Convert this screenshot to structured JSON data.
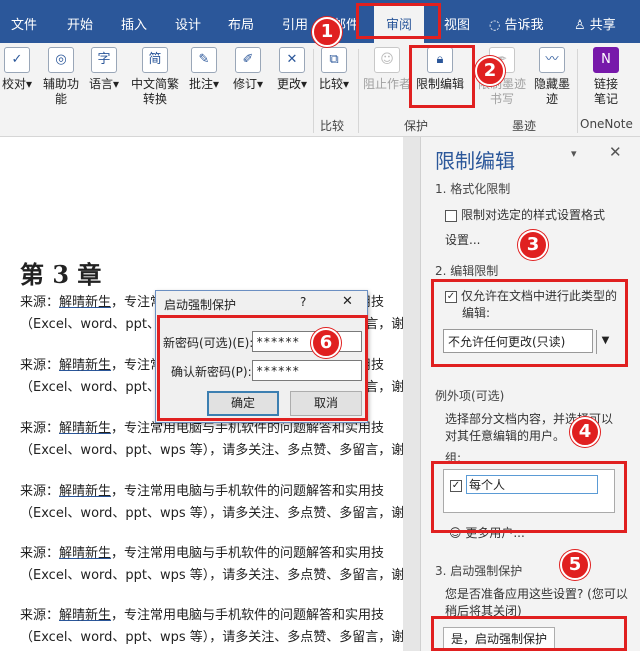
{
  "tabs": {
    "file": "文件",
    "home": "开始",
    "insert": "插入",
    "design": "设计",
    "layout": "布局",
    "references": "引用",
    "mailings": "邮件",
    "review": "审阅",
    "view": "视图",
    "tell_me": "告诉我",
    "share": "共享"
  },
  "ribbon": {
    "proofing": "校对",
    "accessibility": "辅助功能",
    "language": "语言",
    "chinese_convert": "中文简繁转换",
    "comments": "批注",
    "tracking": "修订",
    "changes": "更改",
    "compare": "比较",
    "block_authors": "阻止作者",
    "restrict_editing": "限制编辑",
    "restrict_ink": "限制墨迹书写",
    "hide_ink": "隐藏墨迹",
    "linked_notes": "链接笔记",
    "group_compare": "比较",
    "group_protect": "保护",
    "group_ink": "墨迹",
    "group_onenote": "OneNote"
  },
  "document": {
    "chapter": "第 3 章",
    "para_prefix": "来源：",
    "para_name": "解晴新生",
    "para_rest": "，专注常用电脑与手机软件的问题解答和实用技",
    "para_line2": "（Excel、word、ppt、wps 等），请多关注、多点赞、多留言，谢"
  },
  "dialog": {
    "title": "启动强制保护",
    "help": "?",
    "close": "✕",
    "new_password_label": "新密码(可选)(E):",
    "new_password_value": "******",
    "confirm_password_label": "确认新密码(P):",
    "confirm_password_value": "******",
    "ok": "确定",
    "cancel": "取消"
  },
  "panel": {
    "title": "限制编辑",
    "section1": "1. 格式化限制",
    "format_check": "限制对选定的样式设置格式",
    "settings_link": "设置...",
    "section2": "2. 编辑限制",
    "edit_check_line1": "仅允许在文档中进行此类型的",
    "edit_check_line2": "编辑:",
    "edit_type": "不允许任何更改(只读)",
    "exceptions_title": "例外项(可选)",
    "exceptions_desc1": "选择部分文档内容，并选择可以",
    "exceptions_desc2": "对其任意编辑的用户。",
    "group_label": "组:",
    "everyone": "每个人",
    "more_users": "更多用户...",
    "section3": "3. 启动强制保护",
    "ready_line1": "您是否准备应用这些设置? (您可以",
    "ready_line2": "稍后将其关闭)",
    "enforce_button": "是，启动强制保护"
  },
  "badges": [
    "1",
    "2",
    "3",
    "4",
    "5",
    "6"
  ],
  "colors": {
    "accent": "#2b579a",
    "annotation_red": "#e02020",
    "onenote": "#7719aa"
  }
}
